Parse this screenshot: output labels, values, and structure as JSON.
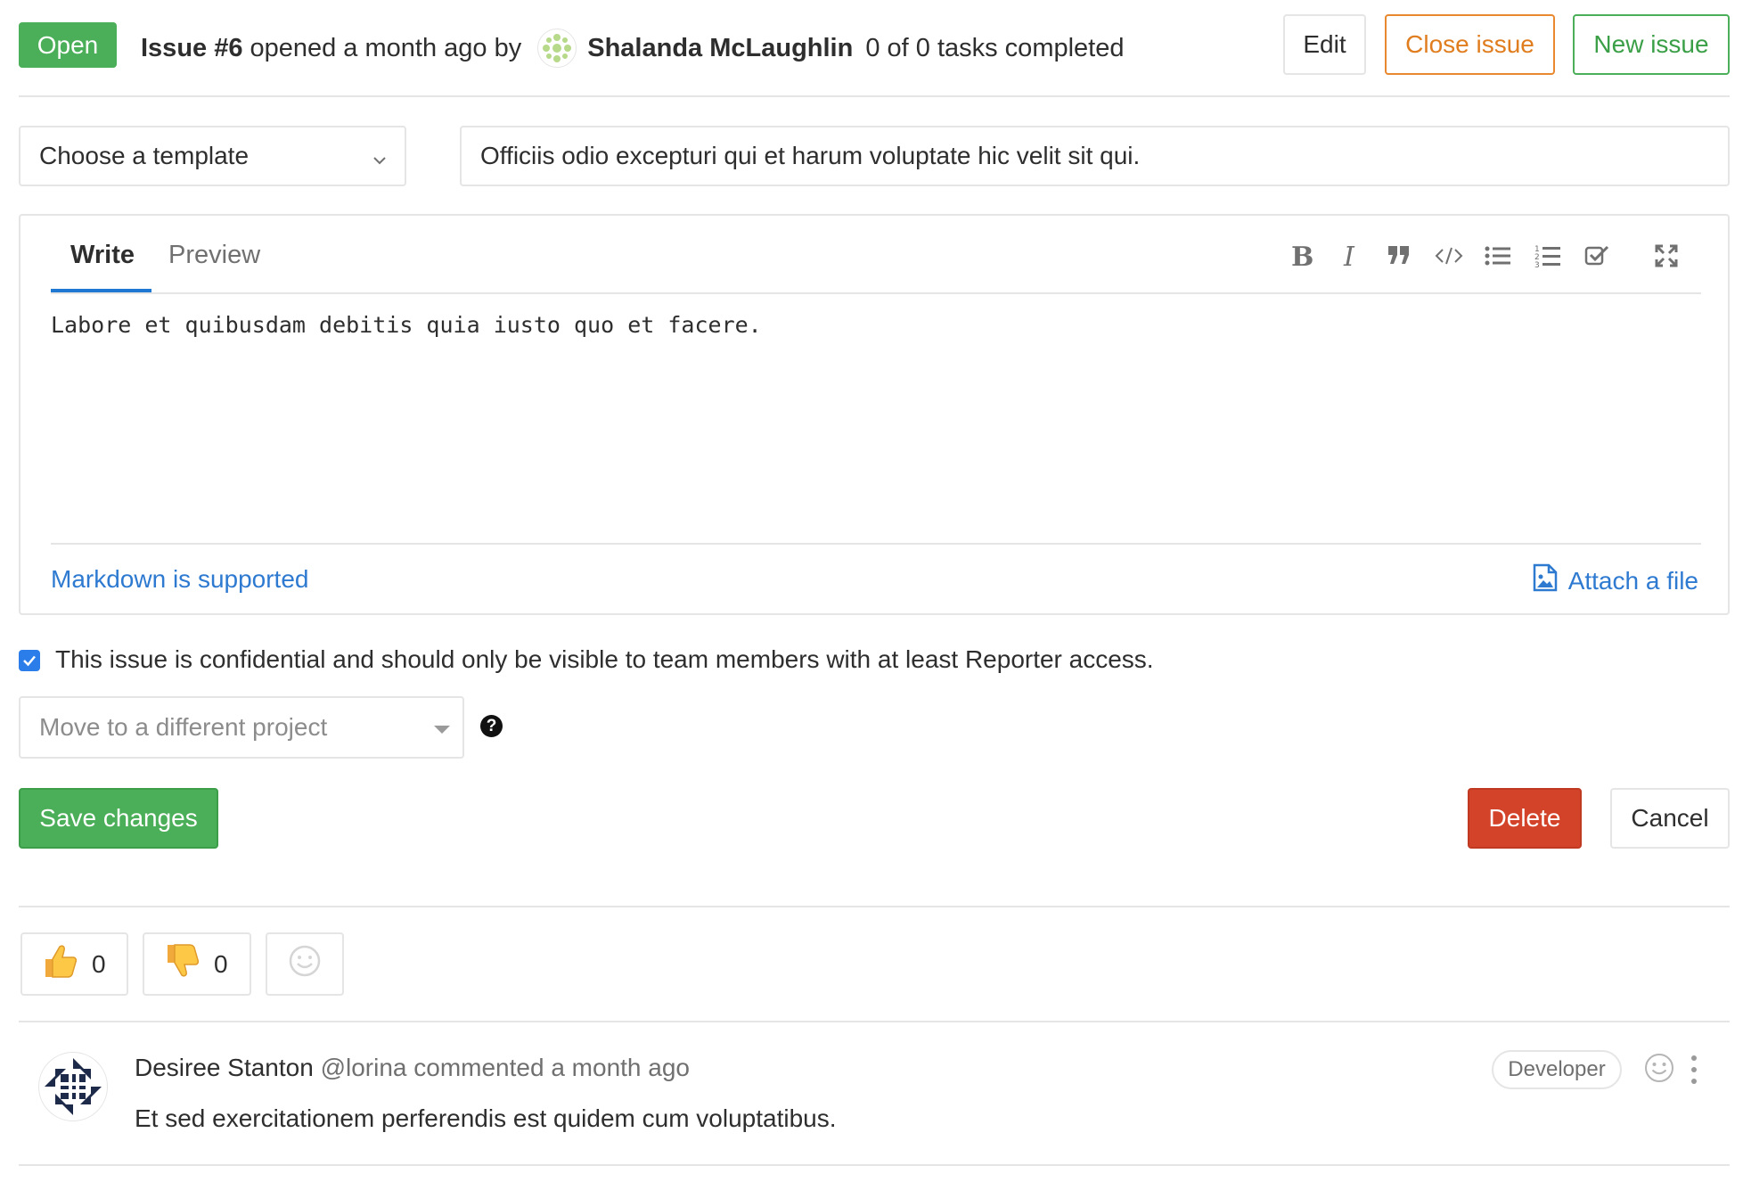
{
  "header": {
    "status": "Open",
    "issue_ref": "Issue #6",
    "opened_text": "opened a month ago by",
    "author": "Shalanda McLaughlin",
    "tasks": "0 of 0 tasks completed",
    "edit_label": "Edit",
    "close_label": "Close issue",
    "new_label": "New issue"
  },
  "form": {
    "template_select": "Choose a template",
    "title_value": "Officiis odio excepturi qui et harum voluptate hic velit sit qui.",
    "tabs": [
      {
        "label": "Write",
        "active": true
      },
      {
        "label": "Preview",
        "active": false
      }
    ],
    "toolbar_icons": [
      "bold-icon",
      "italic-icon",
      "quote-icon",
      "code-icon",
      "bullet-list-icon",
      "numbered-list-icon",
      "task-list-icon",
      "fullscreen-icon"
    ],
    "description": "Labore et quibusdam debitis quia iusto quo et facere.",
    "markdown_link": "Markdown is supported",
    "attach_label": "Attach a file",
    "confidential_checked": true,
    "confidential_label": "This issue is confidential and should only be visible to team members with at least Reporter access.",
    "move_placeholder": "Move to a different project",
    "help_glyph": "?",
    "save_label": "Save changes",
    "delete_label": "Delete",
    "cancel_label": "Cancel"
  },
  "awards": {
    "thumbs_up_count": "0",
    "thumbs_down_count": "0"
  },
  "comment": {
    "author": "Desiree Stanton",
    "username": "@lorina",
    "action": "commented a month ago",
    "role": "Developer",
    "body": "Et sed exercitationem perferendis est quidem cum voluptatibus."
  },
  "colors": {
    "success": "#4bae58",
    "warning": "#e07d1f",
    "danger": "#d3432a",
    "link": "#2e7ad1"
  }
}
